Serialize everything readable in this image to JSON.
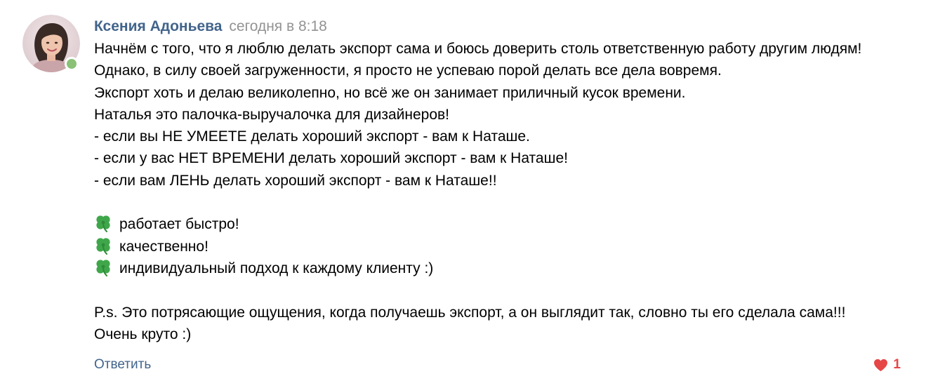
{
  "comment": {
    "author": "Ксения Адоньева",
    "date": "сегодня в 8:18",
    "online": true,
    "lines": [
      {
        "text": "Начнём с того, что я люблю делать экспорт сама и боюсь доверить столь ответственную работу другим людям!",
        "icon": ""
      },
      {
        "text": "Однако, в силу своей загруженности, я просто не успеваю порой делать все дела вовремя.",
        "icon": ""
      },
      {
        "text": "Экспорт хоть и делаю великолепно, но всё же он занимает приличный кусок времени.",
        "icon": ""
      },
      {
        "text": "Наталья это палочка-выручалочка для дизайнеров!",
        "icon": ""
      },
      {
        "text": "- если вы НЕ УМЕЕТЕ делать хороший экспорт - вам к Наташе.",
        "icon": ""
      },
      {
        "text": "- если у вас НЕТ ВРЕМЕНИ делать хороший экспорт - вам к Наташе!",
        "icon": ""
      },
      {
        "text": "- если вам ЛЕНЬ делать хороший экспорт - вам к Наташе!!",
        "icon": ""
      },
      {
        "text": "",
        "icon": ""
      },
      {
        "text": "работает быстро!",
        "icon": "four-leaf-clover-icon"
      },
      {
        "text": "качественно!",
        "icon": "four-leaf-clover-icon"
      },
      {
        "text": "индивидуальный подход к каждому клиенту :)",
        "icon": "four-leaf-clover-icon"
      },
      {
        "text": "",
        "icon": ""
      },
      {
        "text": "P.s. Это потрясающие ощущения, когда получаешь экспорт, а он выглядит так, словно ты его сделала сама!!!",
        "icon": ""
      },
      {
        "text": "Очень круто :)",
        "icon": ""
      }
    ],
    "reply_label": "Ответить",
    "likes": "1"
  },
  "colors": {
    "link": "#42648b",
    "meta": "#939393",
    "online": "#8ac176",
    "like": "#e64646",
    "clover": "#3fa74a"
  }
}
